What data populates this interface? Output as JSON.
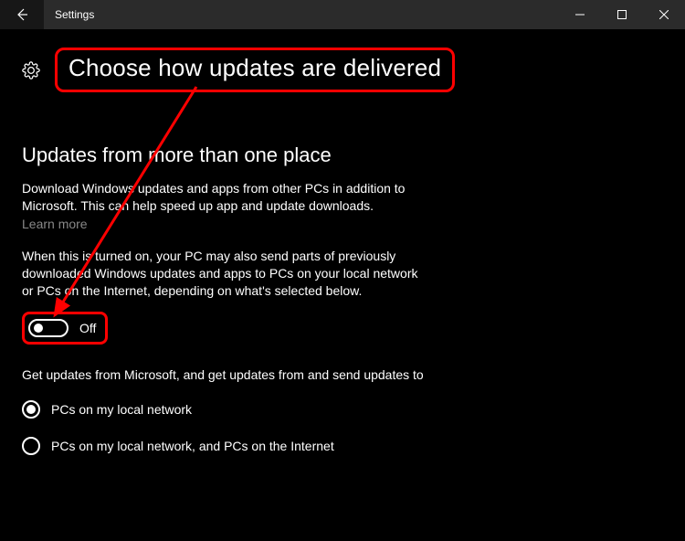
{
  "window": {
    "title": "Settings"
  },
  "page": {
    "title": "Choose how updates are delivered"
  },
  "section": {
    "heading": "Updates from more than one place",
    "para1": "Download Windows updates and apps from other PCs in addition to Microsoft. This can help speed up app and update downloads.",
    "learn_more": "Learn more",
    "para2": "When this is turned on, your PC may also send parts of previously downloaded Windows updates and apps to PCs on your local network or PCs on the Internet, depending on what's selected below."
  },
  "toggle": {
    "state_label": "Off"
  },
  "radio": {
    "prompt": "Get updates from Microsoft, and get updates from and send updates to",
    "option1": "PCs on my local network",
    "option2": "PCs on my local network, and PCs on the Internet"
  }
}
